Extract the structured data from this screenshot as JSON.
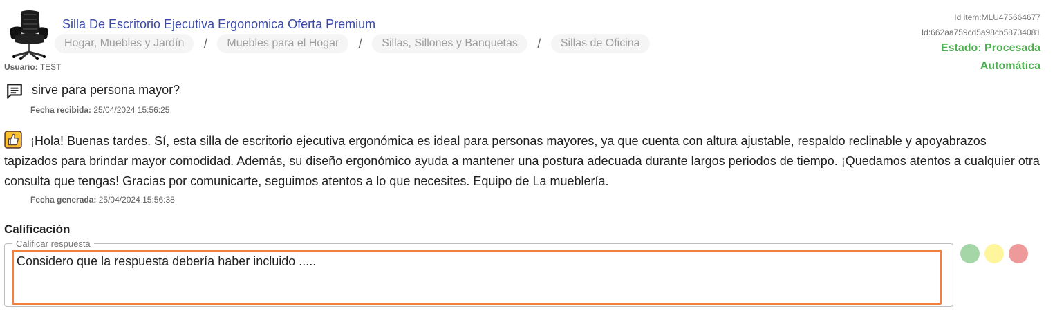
{
  "item": {
    "title": "Silla De Escritorio Ejecutiva Ergonomica Oferta Premium",
    "image_icon": "office-chair-photo",
    "breadcrumb": [
      "Hogar, Muebles y Jardín",
      "Muebles para el Hogar",
      "Sillas, Sillones y Banquetas",
      "Sillas de Oficina"
    ],
    "breadcrumb_separator": "/"
  },
  "user": {
    "label": "Usuario:",
    "value": "TEST"
  },
  "ids": {
    "item_id": "Id item:MLU475664677",
    "record_id": "Id:662aa759cd5a98cb58734081"
  },
  "status": {
    "line1": "Estado: Procesada",
    "line2": "Automática",
    "color": "#4caf50"
  },
  "question": {
    "icon": "message-icon",
    "text": "sirve para persona mayor?",
    "date_label": "Fecha recibida:",
    "date_value": "25/04/2024 15:56:25"
  },
  "answer": {
    "icon": "thumbs-up-icon",
    "text": "¡Hola! Buenas tardes. Sí, esta silla de escritorio ejecutiva ergonómica es ideal para personas mayores, ya que cuenta con altura ajustable, respaldo reclinable y apoyabrazos tapizados para brindar mayor comodidad. Además, su diseño ergonómico ayuda a mantener una postura adecuada durante largos periodos de tiempo. ¡Quedamos atentos a cualquier otra consulta que tengas! Gracias por comunicarte, seguimos atentos a lo que necesites. Equipo de La mueblería.",
    "date_label": "Fecha generada:",
    "date_value": "25/04/2024 15:56:38"
  },
  "rating": {
    "heading": "Calificación",
    "field_label": "Calificar respuesta",
    "value": "Considero que la respuesta debería haber incluido .....",
    "options": [
      {
        "name": "green",
        "color": "#a5d6a7"
      },
      {
        "name": "yellow",
        "color": "#fff59d"
      },
      {
        "name": "red",
        "color": "#ef9a9a"
      }
    ],
    "focus_color": "#f2803b"
  }
}
